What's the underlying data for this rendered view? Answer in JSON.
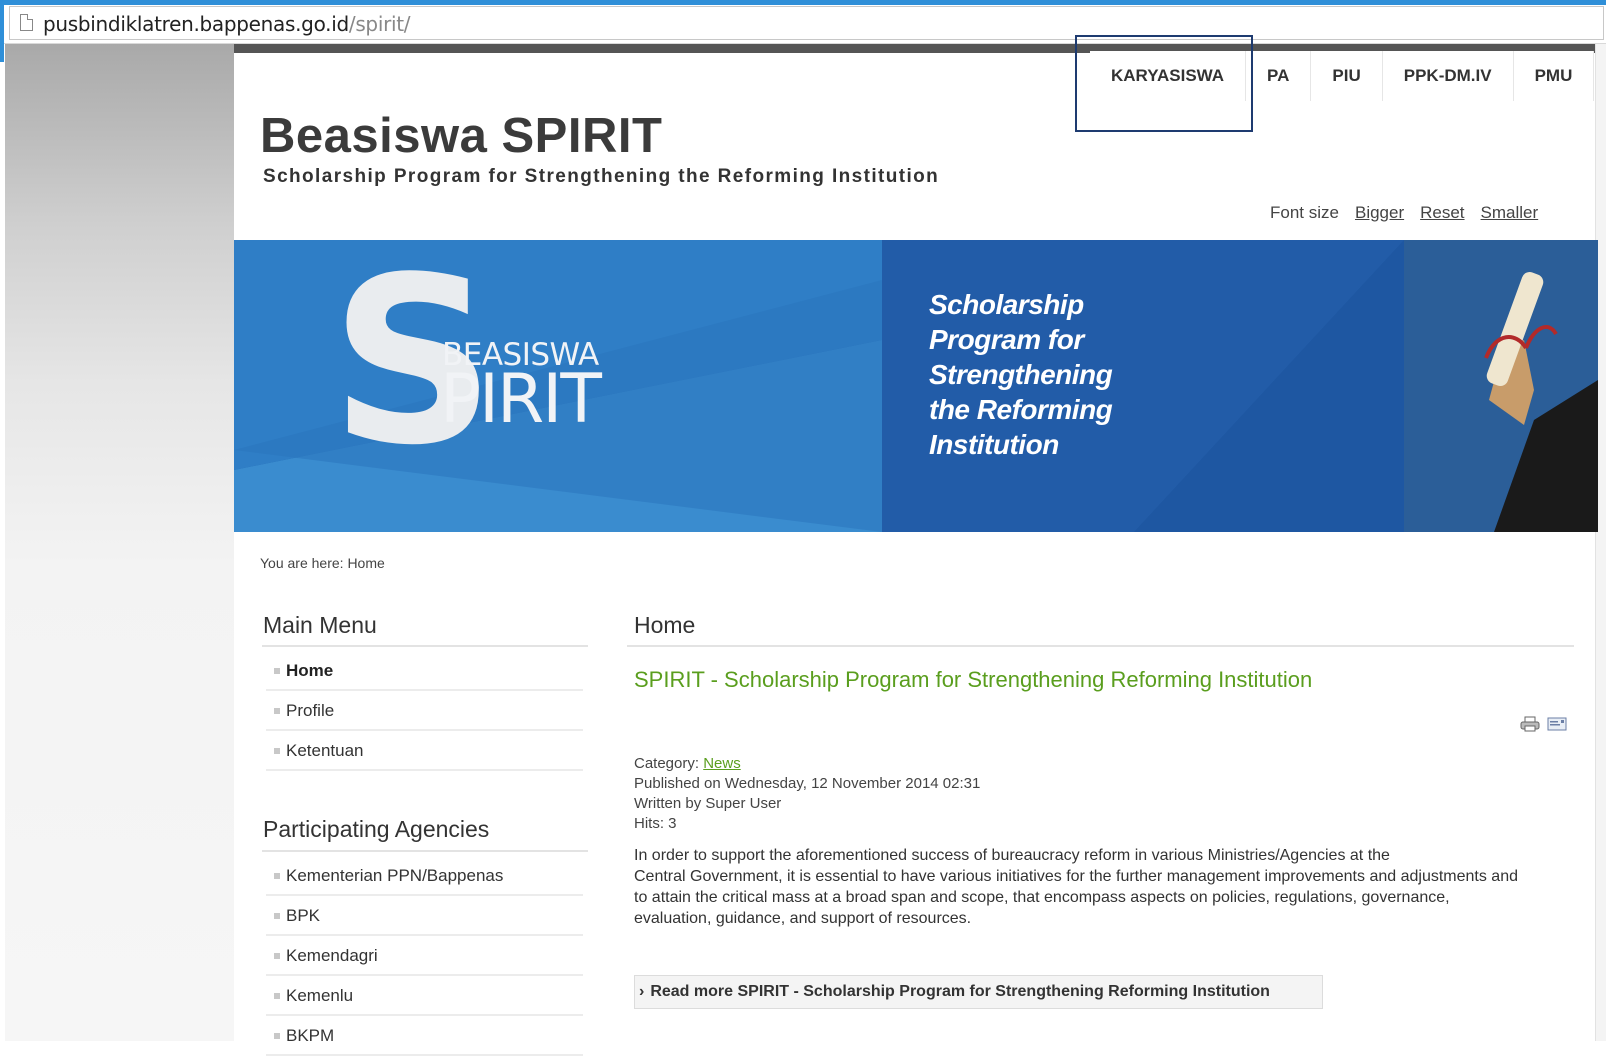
{
  "browser": {
    "url_domain": "pusbindiklatren.bappenas.go.id",
    "url_path": "/spirit/"
  },
  "nav": {
    "items": [
      "KARYASISWA",
      "PA",
      "PIU",
      "PPK-DM.IV",
      "PMU"
    ]
  },
  "header": {
    "title": "Beasiswa SPIRIT",
    "subtitle": "Scholarship Program for Strengthening the Reforming Institution"
  },
  "fontsize": {
    "label": "Font size",
    "bigger": "Bigger",
    "reset": "Reset",
    "smaller": "Smaller"
  },
  "banner": {
    "logo_letter": "S",
    "logo_small": "BEASISWA",
    "logo_big": "PIRIT",
    "lines": [
      "Scholarship",
      "Program for",
      "Strengthening",
      "the Reforming",
      "Institution"
    ],
    "colors": {
      "dark": "#1d4f95",
      "mid": "#2a73bf",
      "light": "#3d8ad0"
    }
  },
  "breadcrumb": {
    "text": "You are here:  Home"
  },
  "main_menu": {
    "title": "Main Menu",
    "items": [
      "Home",
      "Profile",
      "Ketentuan"
    ]
  },
  "agencies": {
    "title": "Participating Agencies",
    "items": [
      "Kementerian PPN/Bappenas",
      "BPK",
      "Kemendagri",
      "Kemenlu",
      "BKPM"
    ]
  },
  "article": {
    "section_title": "Home",
    "title": "SPIRIT - Scholarship Program for Strengthening Reforming Institution",
    "category_label": "Category:",
    "category_value": "News",
    "published": "Published on Wednesday, 12 November 2014 02:31",
    "author": "Written by Super User",
    "hits": "Hits: 3",
    "body_lines": [
      "In order to support the aforementioned success of bureaucracy reform in various Ministries/Agencies at the",
      "Central Government, it is essential to have various initiatives for the further management improvements and adjustments and",
      "to attain the critical mass at a broad span and scope, that encompass aspects on policies, regulations, governance,",
      "evaluation, guidance, and support of resources."
    ],
    "read_more": "Read more SPIRIT - Scholarship Program for Strengthening Reforming Institution",
    "accent_color": "#5a9e1e"
  }
}
